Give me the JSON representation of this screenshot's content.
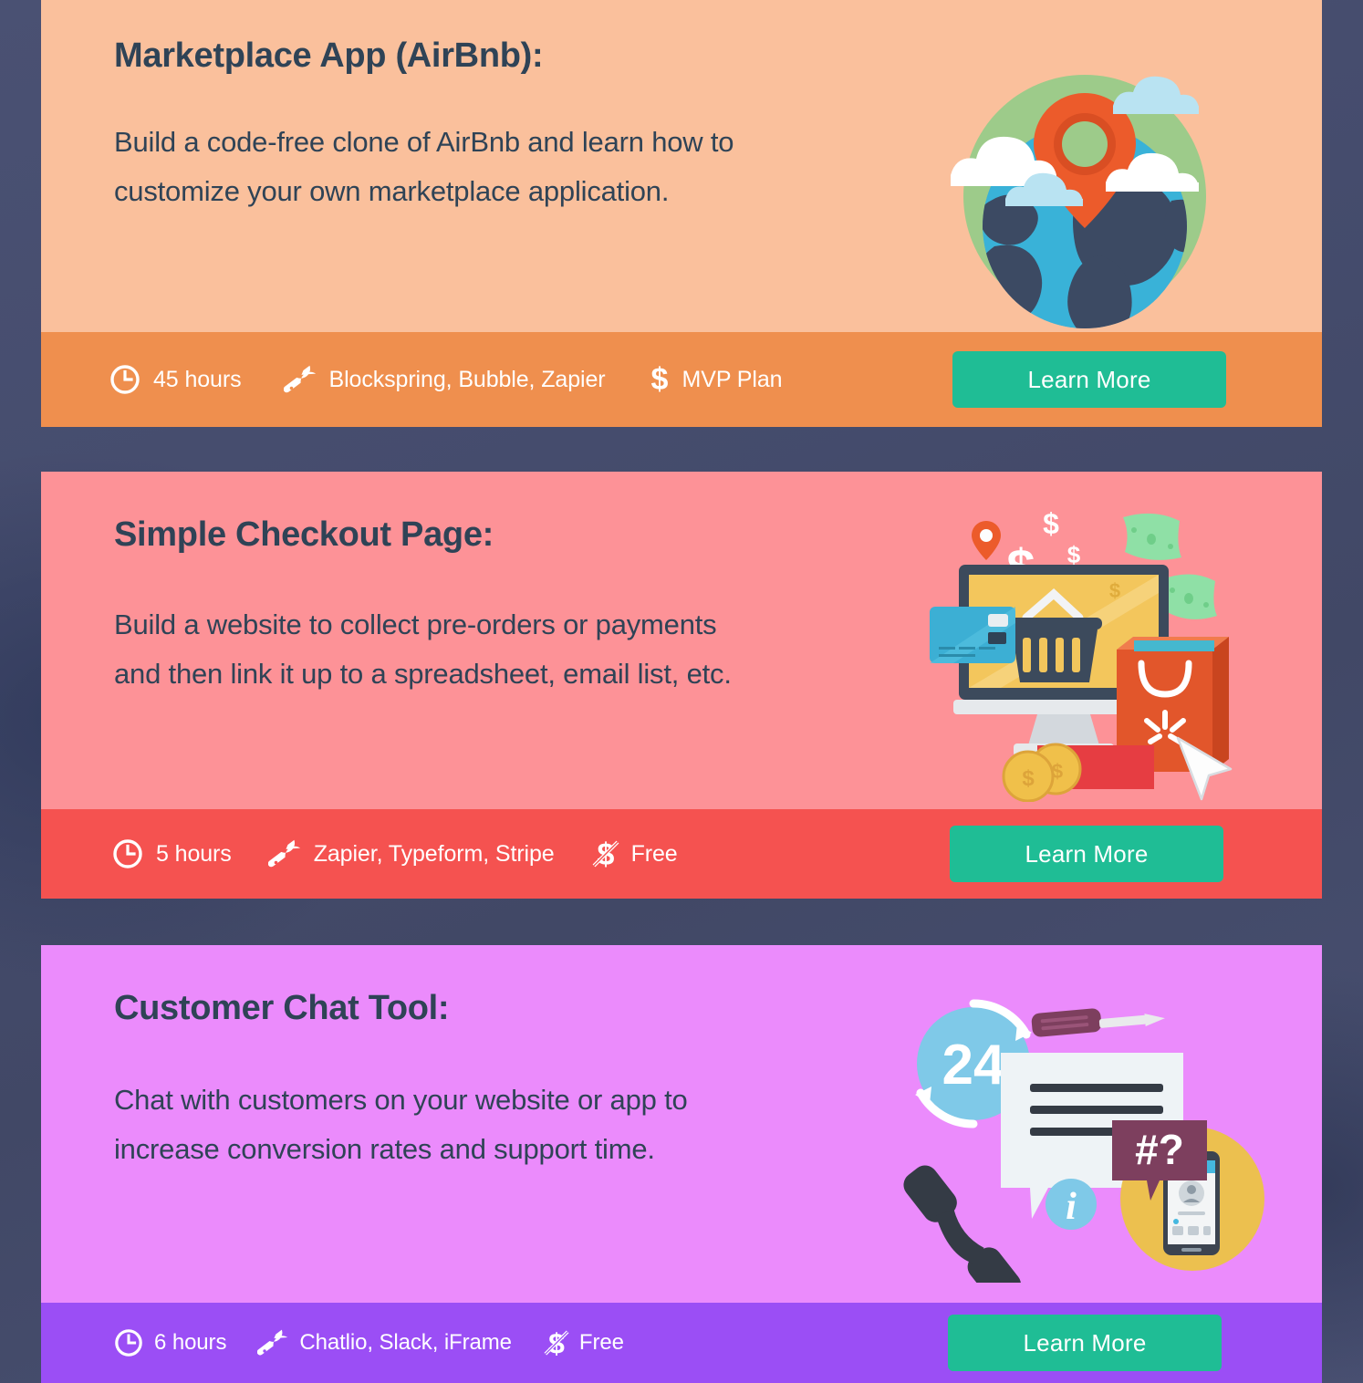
{
  "page": {
    "background_color": "#474e6e",
    "accent_button_color": "#1fbd95",
    "title_text_color": "#2f4356"
  },
  "cards": [
    {
      "id": "marketplace",
      "title": "Marketplace App (AirBnb):",
      "description": "Build a code-free clone of AirBnb and learn how to customize your own marketplace application.",
      "body_color": "#fac09c",
      "footer_color": "#ef8f4e",
      "meta": {
        "duration_icon": "clock-icon",
        "duration": "45 hours",
        "tools_icon": "wrench-icon",
        "tools": "Blockspring, Bubble, Zapier",
        "price_icon": "dollar-icon",
        "price": "MVP Plan",
        "price_is_free": false
      },
      "button_label": "Learn More",
      "illustration": "globe-location-pin-illustration"
    },
    {
      "id": "checkout",
      "title": "Simple Checkout Page:",
      "description": "Build a website to collect pre-orders or payments and then link it up to a spreadsheet, email list, etc.",
      "body_color": "#fd9297",
      "footer_color": "#f55250",
      "meta": {
        "duration_icon": "clock-icon",
        "duration": "5 hours",
        "tools_icon": "wrench-icon",
        "tools": "Zapier, Typeform, Stripe",
        "price_icon": "dollar-slash-icon",
        "price": "Free",
        "price_is_free": true
      },
      "button_label": "Learn More",
      "illustration": "ecommerce-checkout-illustration"
    },
    {
      "id": "chat",
      "title": "Customer Chat Tool:",
      "description": "Chat with customers on your website or app to increase conversion rates and support time.",
      "body_color": "#eb8bfc",
      "footer_color": "#9b4ef5",
      "meta": {
        "duration_icon": "clock-icon",
        "duration": "6 hours",
        "tools_icon": "wrench-icon",
        "tools": "Chatlio, Slack, iFrame",
        "price_icon": "dollar-slash-icon",
        "price": "Free",
        "price_is_free": true
      },
      "button_label": "Learn More",
      "illustration": "customer-support-chat-illustration"
    }
  ]
}
